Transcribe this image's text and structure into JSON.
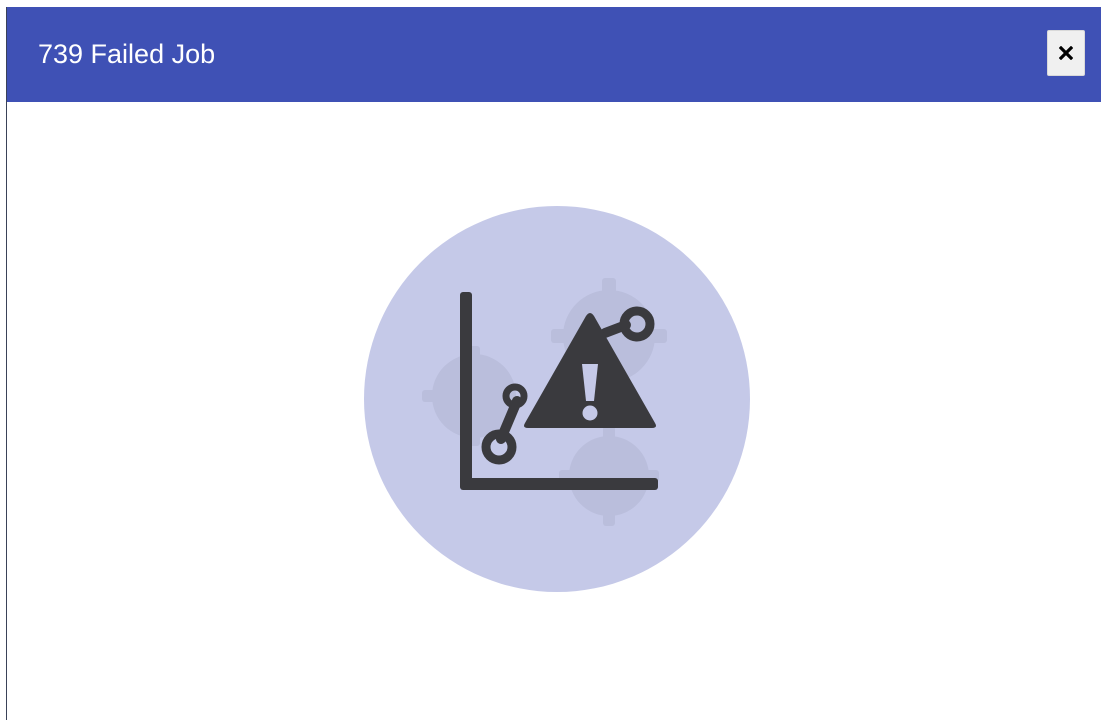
{
  "dialog": {
    "title": "739 Failed Job",
    "close_icon": "close-icon"
  },
  "illustration": {
    "icon": "chart-warning-icon",
    "circle_color": "#c5c9e8",
    "glyph_color": "#3a3a3e"
  },
  "colors": {
    "titlebar": "#3f51b5",
    "title_text": "#ffffff",
    "background": "#ffffff"
  }
}
